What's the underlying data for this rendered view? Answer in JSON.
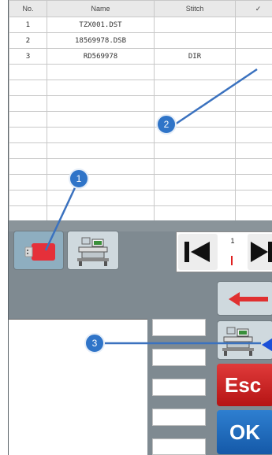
{
  "table": {
    "headers": [
      "No.",
      "Name",
      "Stitch",
      "✓"
    ],
    "rows": [
      {
        "no": "1",
        "name": "TZX001.DST",
        "stitch": "",
        "check": ""
      },
      {
        "no": "2",
        "name": "18569978.DSB",
        "stitch": "",
        "check": ""
      },
      {
        "no": "3",
        "name": "RD569978",
        "stitch": "DIR",
        "check": ""
      }
    ]
  },
  "pager": {
    "current_page": "1"
  },
  "buttons": {
    "esc_label": "Esc",
    "ok_label": "OK"
  },
  "annotations": [
    {
      "label": "1"
    },
    {
      "label": "2"
    },
    {
      "label": "3"
    }
  ],
  "icons": {
    "usb": "usb-drive-icon",
    "machine": "embroidery-machine-icon",
    "first_page": "skip-first-icon",
    "next_page": "skip-next-icon",
    "back": "back-arrow-icon"
  },
  "colors": {
    "panel_bg": "#7f8a91",
    "esc_red": "#c81e1e",
    "ok_blue": "#1e6cc0",
    "marker_blue": "#2f74c8",
    "back_arrow_red": "#e03030"
  }
}
